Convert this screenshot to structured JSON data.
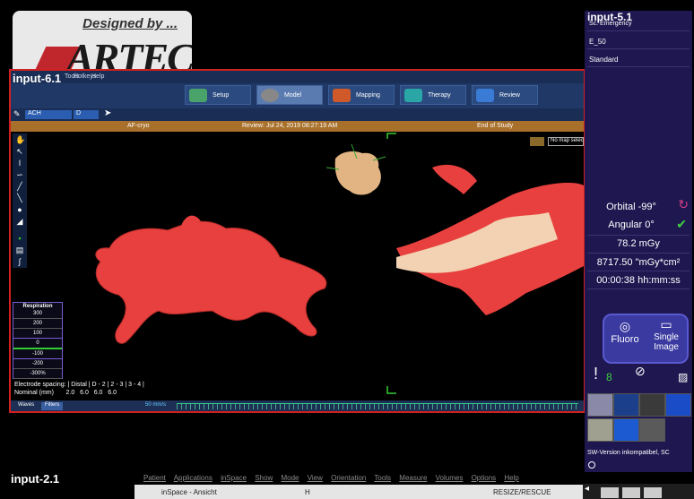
{
  "logo": {
    "designed_by": "Designed by ...",
    "brand": "ARTEC"
  },
  "main_window": {
    "title": "input-6.1",
    "menu": [
      "Tools",
      "Hotkeys",
      "Help"
    ],
    "toolbar": [
      {
        "label": "Setup",
        "color": "#4aa36a",
        "active": false
      },
      {
        "label": "Model",
        "color": "#888888",
        "active": true
      },
      {
        "label": "Mapping",
        "color": "#d0592a",
        "active": false
      },
      {
        "label": "Therapy",
        "color": "#2aa6a6",
        "active": false
      },
      {
        "label": "Review",
        "color": "#3a7bd5",
        "active": false
      }
    ],
    "selector": "ACH",
    "selector2": "D",
    "status": {
      "left": "AF-cryo",
      "center": "Review: Jul 24, 2019 08:27:19 AM",
      "right": "End of Study"
    },
    "no_map": "No map selected",
    "respiration": {
      "title": "Respiration",
      "rows": [
        "300",
        "200",
        "100",
        "0",
        "-100",
        "-200",
        "-300%"
      ]
    },
    "electrode": {
      "line1": "Electrode spacing: | Distal | D - 2 | 2 - 3 | 3 - 4 |",
      "line2": "Nominal (mm)       2.0   6.0   6.0   6.0"
    },
    "bottom_tabs": [
      "Waves",
      "Filters"
    ],
    "speed": "50 mm/s"
  },
  "right_panel": {
    "title": "input-5.1",
    "mode": "Sc. Emergency",
    "e_value": "E_50",
    "standard": "Standard",
    "orbital": "Orbital -99°",
    "angular": "Angular 0°",
    "dose": "78.2 mGy",
    "dap": "8717.50 \"mGy*cm²",
    "time": "00:00:38 hh:mm:ss",
    "fluoro_label": "Fluoro",
    "single_image_label": "Single Image",
    "sw_version": "SW-Version inkompatibel, SC",
    "check_color": "#3fd13f",
    "warn_color": "#d93f8a"
  },
  "bottom_window": {
    "title": "input-2.1",
    "menu": [
      "Patient",
      "Applications",
      "inSpace",
      "Show",
      "Mode",
      "View",
      "Orientation",
      "Tools",
      "Measure",
      "Volumes",
      "Options",
      "Help"
    ],
    "subbar_left": "inSpace - Ansicht",
    "subbar_center": "H",
    "subbar_right": "RESIZE/RESCUE"
  }
}
